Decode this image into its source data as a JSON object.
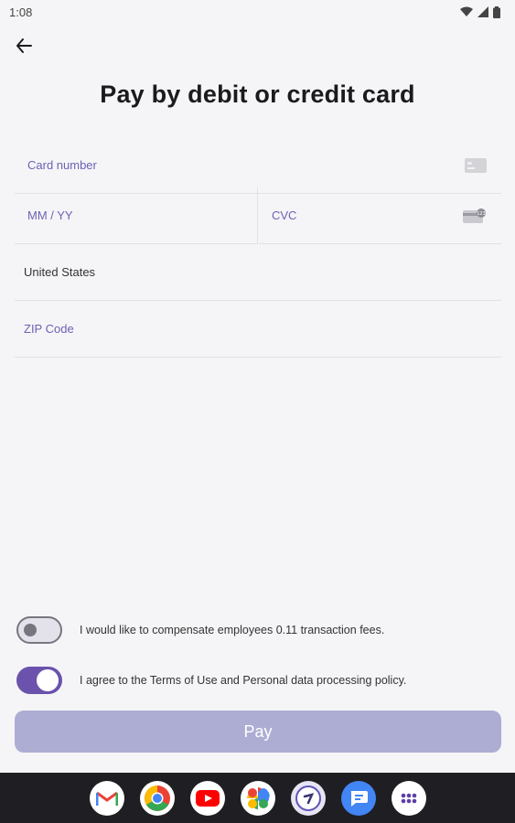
{
  "status_bar": {
    "time": "1:08"
  },
  "header": {
    "title": "Pay by debit or credit card"
  },
  "form": {
    "card_number_placeholder": "Card number",
    "expiry_placeholder": "MM / YY",
    "cvc_placeholder": "CVC",
    "country_value": "United States",
    "zip_placeholder": "ZIP Code"
  },
  "options": [
    {
      "label": "I would like to compensate employees 0.11 transaction fees.",
      "checked": false
    },
    {
      "label": "I agree to the Terms of Use and Personal data processing policy.",
      "checked": true
    }
  ],
  "pay_button": {
    "label": "Pay"
  },
  "dock": {
    "apps": [
      "gmail-icon",
      "chrome-icon",
      "youtube-icon",
      "photos-icon",
      "app-icon",
      "messages-icon",
      "app-drawer-icon"
    ]
  },
  "colors": {
    "accent": "#6b52ad",
    "pay_button": "#adadd4",
    "placeholder": "#6b62b5"
  }
}
